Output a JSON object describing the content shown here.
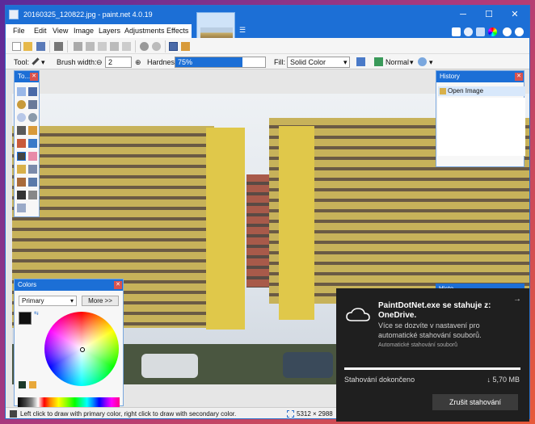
{
  "window": {
    "title": "20160325_120822.jpg - paint.net 4.0.19",
    "controls": {
      "minimize": "─",
      "maximize": "☐",
      "close": "✕"
    }
  },
  "menu": {
    "items": [
      "File",
      "Edit",
      "View",
      "Image",
      "Layers",
      "Adjustments",
      "Effects"
    ]
  },
  "options": {
    "tool_label": "Tool:",
    "brush_width_label": "Brush width:",
    "brush_width_value": "2",
    "hardness_label": "Hardness:",
    "hardness_value": "75%",
    "hardness_fraction": 0.75,
    "fill_label": "Fill:",
    "fill_value": "Solid Color",
    "blend_mode": "Normal"
  },
  "panels": {
    "tools": {
      "title": "To..."
    },
    "history": {
      "title": "History",
      "items": [
        "Open Image"
      ]
    },
    "colors": {
      "title": "Colors",
      "mode": "Primary",
      "more_label": "More >>"
    },
    "obscured_title": "Histo"
  },
  "status": {
    "hint": "Left click to draw with primary color, right click to draw with secondary color.",
    "image_size": "5312 × 2988"
  },
  "toast": {
    "title": "PaintDotNet.exe se stahuje z: OneDrive.",
    "description": "Více se dozvíte v nastavení pro automatické stahování souborů.",
    "subtext": "Automatické stahování souborů",
    "status": "Stahování dokončeno",
    "size": "↓ 5,70 MB",
    "cancel_label": "Zrušit stahování",
    "progress_fraction": 1.0
  },
  "colors": {
    "accent": "#1c6fd6",
    "toast_bg": "#1f1f1f"
  }
}
